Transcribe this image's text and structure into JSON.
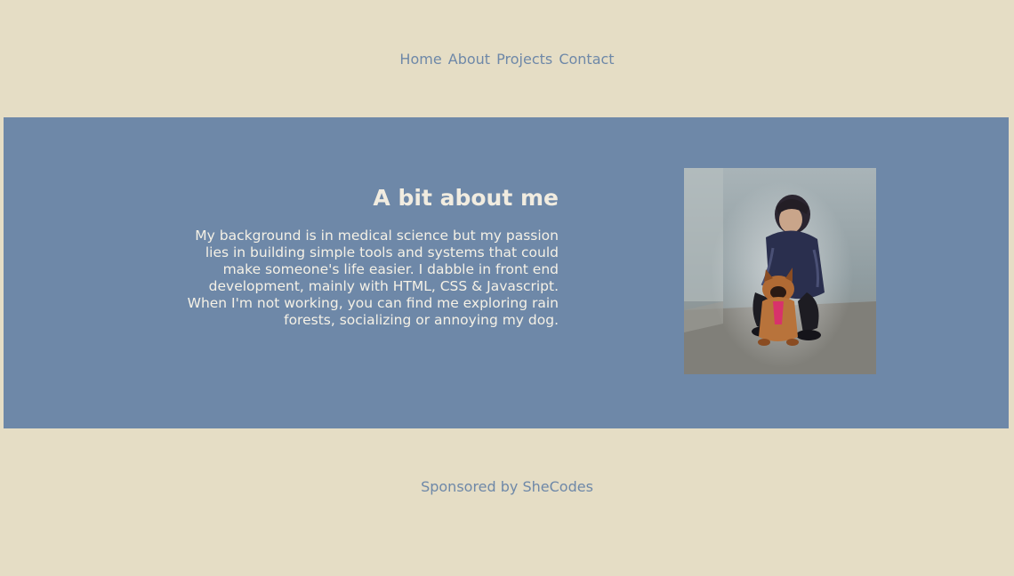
{
  "nav": {
    "items": [
      {
        "label": "Home"
      },
      {
        "label": "About"
      },
      {
        "label": "Projects"
      },
      {
        "label": "Contact"
      }
    ]
  },
  "about": {
    "heading": "A bit about me",
    "body": "My background is in medical science but my passion lies in building simple tools and systems that could make someone's life easier. I dabble in front end development, mainly with HTML, CSS & Javascript. When I'm not working, you can find me exploring rain forests, socializing or annoying my dog."
  },
  "photo": {
    "icon": "portrait-photo-icon",
    "subject": "person-crouching-with-dog"
  },
  "footer": {
    "text": "Sponsored by SheCodes"
  },
  "colors": {
    "background": "#e5ddc5",
    "accent": "#6e88a8",
    "hero_text": "#f5f1e6"
  }
}
